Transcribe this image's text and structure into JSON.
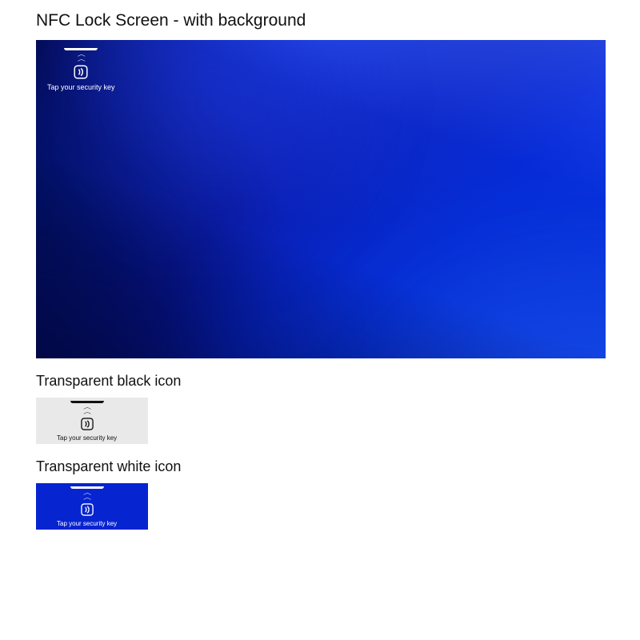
{
  "headings": {
    "main": "NFC Lock Screen - with background",
    "black": "Transparent black icon",
    "white": "Transparent white icon"
  },
  "nfc": {
    "prompt": "Tap your security key"
  }
}
